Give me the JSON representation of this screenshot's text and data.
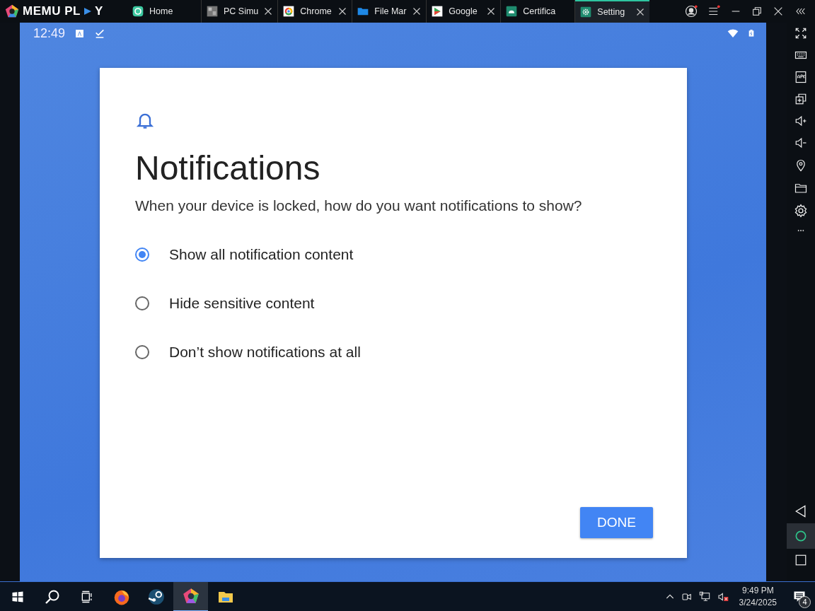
{
  "app": {
    "logo_text": "MEMU PL",
    "logo_text_end": "Y"
  },
  "tabs": [
    {
      "label": "Home",
      "closable": false,
      "selected": false
    },
    {
      "label": "PC Simu",
      "closable": true,
      "selected": false
    },
    {
      "label": "Chrome",
      "closable": true,
      "selected": false
    },
    {
      "label": "File Mar",
      "closable": true,
      "selected": false
    },
    {
      "label": "Google",
      "closable": true,
      "selected": false
    },
    {
      "label": "Certifica",
      "closable": false,
      "selected": false
    },
    {
      "label": "Setting",
      "closable": true,
      "selected": true
    }
  ],
  "status_bar": {
    "time": "12:49"
  },
  "dialog": {
    "title": "Notifications",
    "question": "When your device is locked, how do you want notifications to show?",
    "options": [
      {
        "label": "Show all notification content",
        "selected": true
      },
      {
        "label": "Hide sensitive content",
        "selected": false
      },
      {
        "label": "Don’t show notifications at all",
        "selected": false
      }
    ],
    "done_button": "DONE"
  },
  "taskbar": {
    "time": "9:49 PM",
    "date": "3/24/2025",
    "notification_count": "4"
  }
}
